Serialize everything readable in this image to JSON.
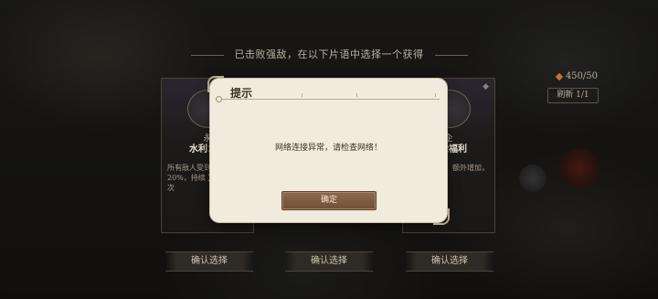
{
  "header": {
    "hint": "已击败强敌，在以下片语中选择一个获得"
  },
  "resources": {
    "counter": "450/50",
    "refresh_label": "刷新 1/1"
  },
  "cards": [
    {
      "subtitle": "永",
      "name": "水利：涉",
      "description": "所有敌人受到伤害提升20%，持续 】的伤害频次"
    },
    {
      "subtitle": "企",
      "name": "体检福利",
      "description": "生生发动时，额外增加，每秒"
    }
  ],
  "confirm_buttons": [
    {
      "label": "确认选择"
    },
    {
      "label": "确认选择"
    },
    {
      "label": "确认选择"
    }
  ],
  "dialog": {
    "title": "提示",
    "message": "网络连接异常，请检查网络！",
    "ok_label": "确定"
  },
  "colors": {
    "dialog_bg": "#f1ebdd",
    "ok_button": "#7a5a40",
    "overlay": "#1e1c1a"
  }
}
